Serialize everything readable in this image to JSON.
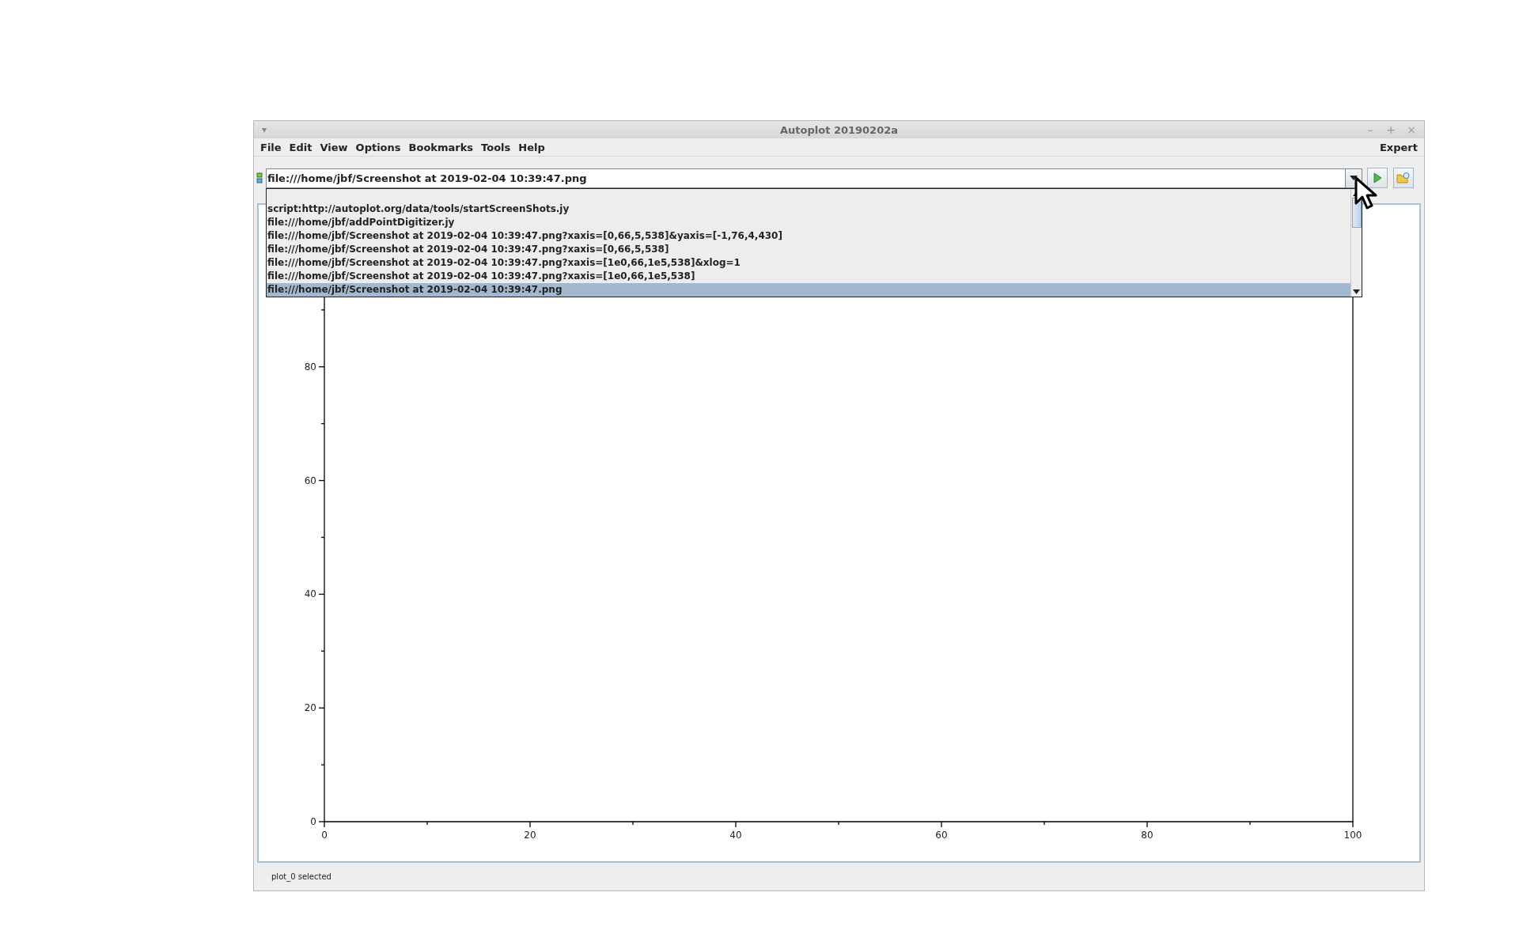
{
  "window": {
    "menu_glyph": "▾",
    "title": "Autoplot 20190202a",
    "controls": [
      "–",
      "+",
      "×"
    ]
  },
  "menu": [
    "File",
    "Edit",
    "View",
    "Options",
    "Bookmarks",
    "Tools",
    "Help"
  ],
  "menu_right": "Expert",
  "address": {
    "value": "file:///home/jbf/Screenshot at 2019-02-04 10:39:47.png"
  },
  "history": [
    {
      "text": "script:http://autoplot.org/data/tools/startScreenShots.jy",
      "selected": false
    },
    {
      "text": "file:///home/jbf/addPointDigitizer.jy",
      "selected": false
    },
    {
      "text": "file:///home/jbf/Screenshot at 2019-02-04 10:39:47.png?xaxis=[0,66,5,538]&yaxis=[-1,76,4,430]",
      "selected": false
    },
    {
      "text": "file:///home/jbf/Screenshot at 2019-02-04 10:39:47.png?xaxis=[0,66,5,538]",
      "selected": false
    },
    {
      "text": "file:///home/jbf/Screenshot at 2019-02-04 10:39:47.png?xaxis=[1e0,66,1e5,538]&xlog=1",
      "selected": false
    },
    {
      "text": "file:///home/jbf/Screenshot at 2019-02-04 10:39:47.png?xaxis=[1e0,66,1e5,538]",
      "selected": false
    },
    {
      "text": "file:///home/jbf/Screenshot at 2019-02-04 10:39:47.png",
      "selected": true
    }
  ],
  "plot": {
    "xticks": [
      "0",
      "20",
      "40",
      "60",
      "80",
      "100"
    ],
    "yticks": [
      "80",
      "60",
      "40",
      "20",
      "0"
    ]
  },
  "status_bar": "plot_0 selected"
}
